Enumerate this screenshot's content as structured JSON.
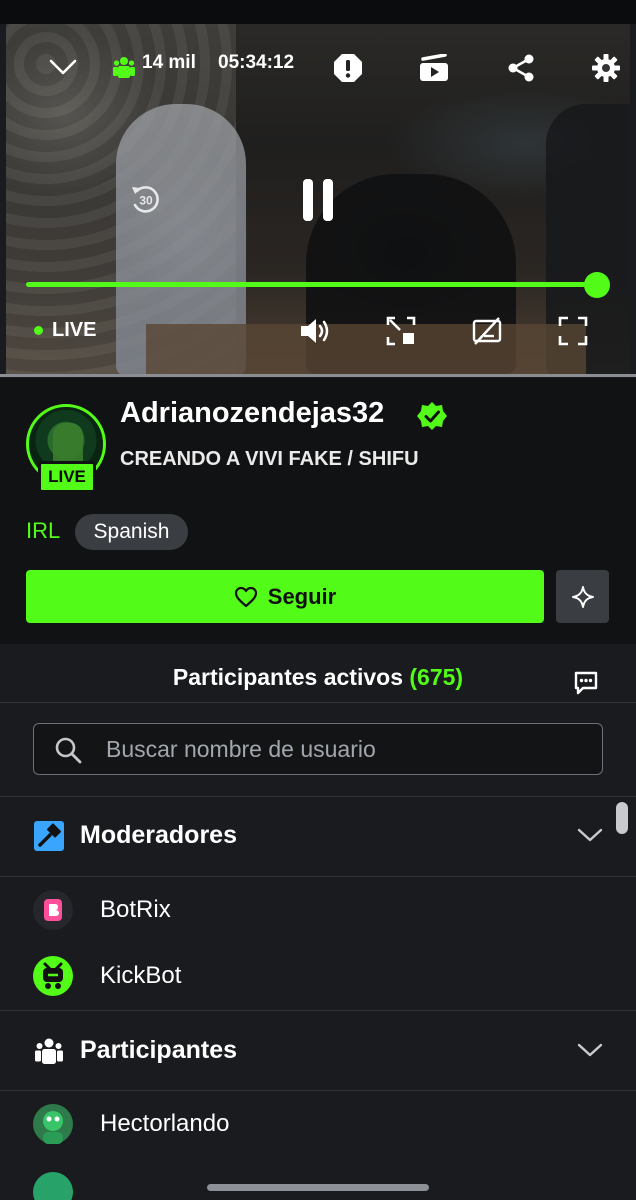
{
  "player": {
    "viewer_count": "14 mil",
    "timer": "05:34:12",
    "live_label": "LIVE",
    "progress_fraction": 1.0
  },
  "channel": {
    "name": "Adrianozendejas32",
    "stream_title": "CREANDO A VIVI FAKE / SHIFU",
    "live_badge": "LIVE",
    "category": "IRL",
    "language": "Spanish",
    "follow_label": "Seguir"
  },
  "participants": {
    "title": "Participantes activos",
    "count": "(675)",
    "search_placeholder": "Buscar nombre de usuario",
    "moderators_label": "Moderadores",
    "moderators": [
      "BotRix",
      "KickBot"
    ],
    "participants_label": "Participantes",
    "users": [
      "Hectorlando"
    ]
  },
  "colors": {
    "accent": "#53fc18",
    "background": "#191b1f",
    "header_bg": "#111213"
  },
  "icons": {
    "chevron_down": "chevron-down-icon",
    "viewers": "viewers-icon",
    "report": "report-icon",
    "clip": "clip-icon",
    "share": "share-icon",
    "settings": "gear-icon",
    "rewind": "rewind-30-icon",
    "pause": "pause-icon",
    "volume": "volume-icon",
    "minimize": "minimize-icon",
    "captions_off": "captions-off-icon",
    "fullscreen": "fullscreen-icon",
    "verified": "verified-badge-icon",
    "heart": "heart-icon",
    "sparkle": "sparkle-icon",
    "chat": "chat-icon",
    "search": "search-icon",
    "hammer": "hammer-icon",
    "people": "people-icon"
  }
}
